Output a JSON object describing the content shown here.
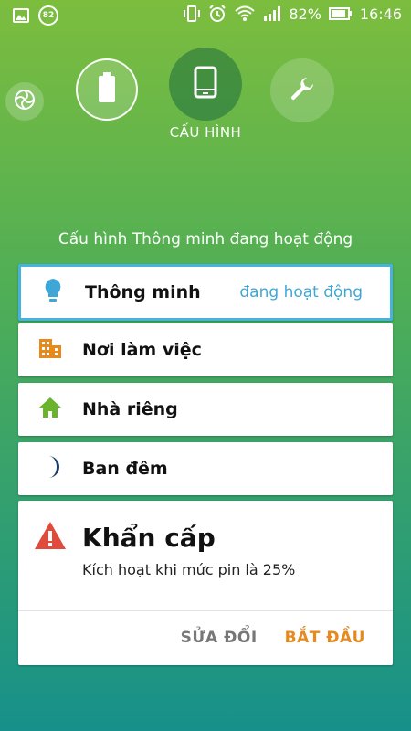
{
  "status_bar": {
    "notification_count": "82",
    "battery_percent": "82%",
    "time": "16:46",
    "icons": [
      "image-icon",
      "vibrate-icon",
      "alarm-icon",
      "wifi-icon",
      "signal-icon",
      "battery-icon"
    ]
  },
  "modes": {
    "items": [
      {
        "name": "smart",
        "icon": "avast-smart-icon"
      },
      {
        "name": "battery",
        "icon": "battery-icon"
      },
      {
        "name": "phone",
        "icon": "phone-icon",
        "selected": true
      },
      {
        "name": "tools",
        "icon": "wrench-icon"
      }
    ],
    "selected_label": "CẤU HÌNH"
  },
  "status_line": "Cấu hình Thông minh đang hoạt động",
  "profiles": [
    {
      "label": "Thông minh",
      "status": "đang hoạt động",
      "icon": "bulb-icon",
      "icon_color": "#3fa7d8"
    },
    {
      "label": "Nơi làm việc",
      "icon": "building-icon",
      "icon_color": "#e68a1e"
    },
    {
      "label": "Nhà riêng",
      "icon": "home-icon",
      "icon_color": "#6ab42d"
    },
    {
      "label": "Ban đêm",
      "icon": "moon-icon",
      "icon_color": "#1d3e6a"
    }
  ],
  "emergency": {
    "title": "Khẩn cấp",
    "subtitle": "Kích hoạt khi mức pin là 25%",
    "edit_label": "SỬA ĐỔI",
    "start_label": "BẮT ĐẦU",
    "icon": "warning-icon",
    "icon_color": "#e04b3c"
  },
  "colors": {
    "accent_blue": "#45b3dd",
    "accent_orange": "#e68a1e"
  }
}
